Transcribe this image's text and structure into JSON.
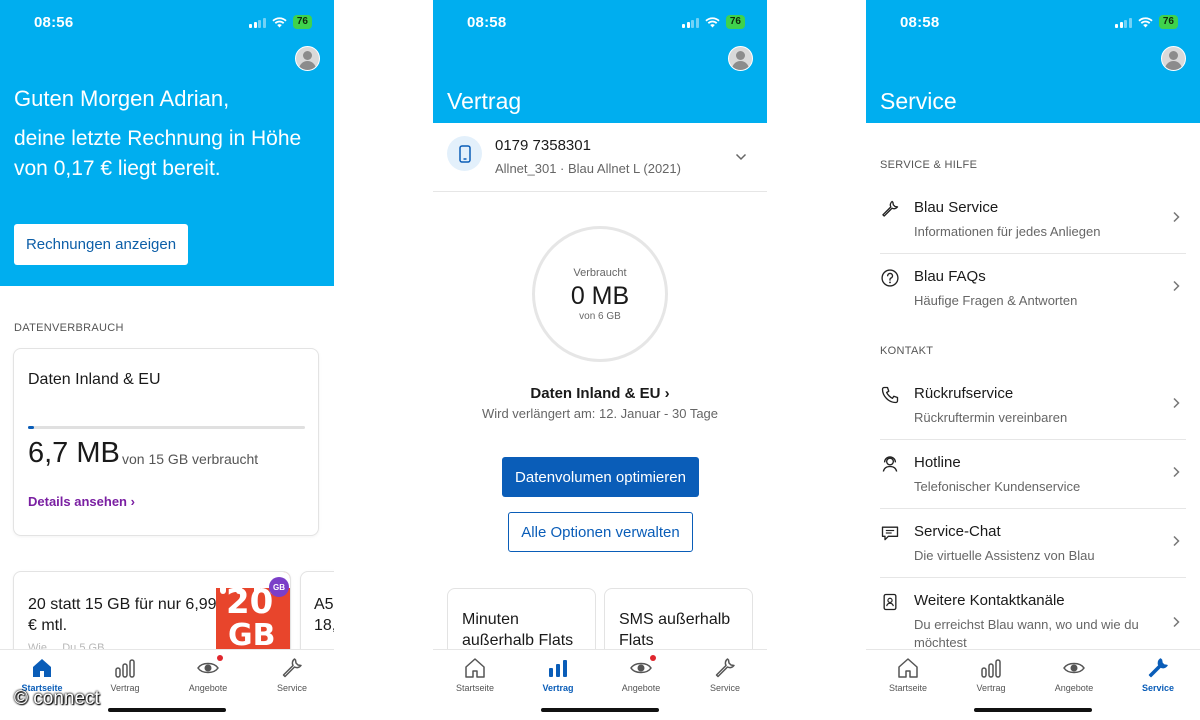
{
  "screens": {
    "home": {
      "time": "08:56",
      "battery": "76",
      "greeting": "Guten Morgen Adrian,",
      "invoice_text": "deine letzte Rechnung in Höhe von 0,17 € liegt bereit.",
      "invoice_button": "Rechnungen anzeigen",
      "section_label": "DATENVERBRAUCH",
      "usage_card": {
        "title": "Daten Inland & EU",
        "used": "6,7 MB",
        "of_text": "von 15 GB verbraucht",
        "used_fraction": 0.0004,
        "details_link": "Details ansehen ›"
      },
      "promo": {
        "text": "20 statt 15 GB für nur 6,99 € mtl.",
        "fade_text": "Wie ... Du 5 GB ...",
        "image_number": "20",
        "image_unit": "GB",
        "image_badge": "GB",
        "next_card_text": "A5 18,"
      }
    },
    "vertrag": {
      "time": "08:58",
      "battery": "76",
      "title": "Vertrag",
      "phone_number": "0179 7358301",
      "plan": "Allnet_301 · Blau Allnet L (2021)",
      "ring": {
        "label": "Verbraucht",
        "value": "0 MB",
        "of": "von 6 GB",
        "used_fraction": 0
      },
      "data_title": "Daten Inland & EU ›",
      "renewal": "Wird verlängert am: 12. Januar - 30 Tage",
      "primary_button": "Datenvolumen optimieren",
      "secondary_button": "Alle Optionen verwalten",
      "mini_cards": [
        "Minuten außerhalb Flats",
        "SMS außerhalb Flats"
      ]
    },
    "service": {
      "time": "08:58",
      "battery": "76",
      "title": "Service",
      "section_help": "SERVICE & HILFE",
      "help_items": [
        {
          "title": "Blau Service",
          "subtitle": "Informationen für jedes Anliegen",
          "icon": "wrench-icon"
        },
        {
          "title": "Blau FAQs",
          "subtitle": "Häufige Fragen & Antworten",
          "icon": "question-icon"
        }
      ],
      "section_contact": "KONTAKT",
      "contact_items": [
        {
          "title": "Rückrufservice",
          "subtitle": "Rückruftermin vereinbaren",
          "icon": "phone-icon"
        },
        {
          "title": "Hotline",
          "subtitle": "Telefonischer Kundenservice",
          "icon": "headset-icon"
        },
        {
          "title": "Service-Chat",
          "subtitle": "Die virtuelle Assistenz von Blau",
          "icon": "chat-icon"
        },
        {
          "title": "Weitere Kontaktkanäle",
          "subtitle": "Du erreichst Blau wann, wo und wie du möchtest",
          "icon": "contact-card-icon"
        }
      ]
    }
  },
  "nav": {
    "items": [
      "Startseite",
      "Vertrag",
      "Angebote",
      "Service"
    ]
  },
  "colors": {
    "brand": "#00aeef",
    "primary": "#0a5db8",
    "link": "#7a1fa2",
    "notify": "#e0262d"
  },
  "watermark": "© connect"
}
